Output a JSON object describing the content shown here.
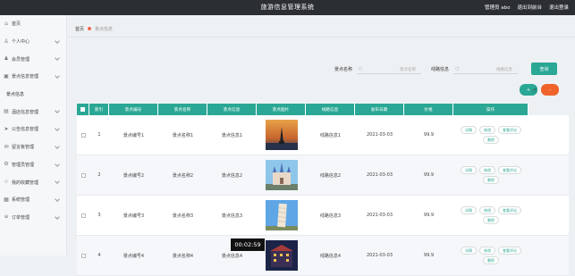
{
  "topbar": {
    "title": "旅游信息管理系统",
    "admin": "管理员 abo",
    "exit_console": "退出到前台",
    "logout": "退出登录"
  },
  "sidebar": {
    "items": [
      {
        "label": "首页",
        "icon": "home-icon",
        "chevron": false
      },
      {
        "label": "个人中心",
        "icon": "user-icon",
        "chevron": true
      },
      {
        "label": "会员管理",
        "icon": "users-icon",
        "chevron": true
      },
      {
        "label": "景点信息管理",
        "icon": "map-icon",
        "chevron": true
      },
      {
        "label": "景点信息",
        "icon": "",
        "chevron": false,
        "sub": true
      },
      {
        "label": "酒店信息管理",
        "icon": "hotel-icon",
        "chevron": true
      },
      {
        "label": "公告信息管理",
        "icon": "send-icon",
        "chevron": true
      },
      {
        "label": "留言板管理",
        "icon": "message-icon",
        "chevron": true
      },
      {
        "label": "管理员管理",
        "icon": "gear-icon",
        "chevron": true
      },
      {
        "label": "我的收藏管理",
        "icon": "star-icon",
        "chevron": true
      },
      {
        "label": "系统管理",
        "icon": "system-icon",
        "chevron": true
      },
      {
        "label": "订单管理",
        "icon": "order-icon",
        "chevron": true
      }
    ]
  },
  "breadcrumb": {
    "home": "首页",
    "current": "景点信息"
  },
  "search": {
    "name_label": "景点名称",
    "name_placeholder": "景点名称",
    "route_label": "线路信息",
    "route_placeholder": "线路信息",
    "query_label": "查询"
  },
  "actions": {
    "add": "+",
    "delete": "-"
  },
  "table": {
    "headers": [
      "索引",
      "景点编号",
      "景点名称",
      "景点信息",
      "景点图片",
      "线路信息",
      "发布日期",
      "价格",
      "操作"
    ],
    "rows": [
      {
        "index": "1",
        "code": "景点编号1",
        "name": "景点名称1",
        "info": "景点信息1",
        "route": "线路信息1",
        "date": "2021-03-03",
        "price": "99.9",
        "img": "sunset"
      },
      {
        "index": "2",
        "code": "景点编号2",
        "name": "景点名称2",
        "info": "景点信息2",
        "route": "线路信息2",
        "date": "2021-03-03",
        "price": "99.9",
        "img": "castle"
      },
      {
        "index": "3",
        "code": "景点编号3",
        "name": "景点名称3",
        "info": "景点信息3",
        "route": "线路信息3",
        "date": "2021-03-03",
        "price": "99.9",
        "img": "tower"
      },
      {
        "index": "4",
        "code": "景点编号4",
        "name": "景点名称4",
        "info": "景点信息4",
        "route": "线路信息4",
        "date": "2021-03-03",
        "price": "99.9",
        "img": "night"
      }
    ],
    "ops": [
      "详情",
      "修改",
      "查看评论",
      "删除"
    ]
  },
  "video_timer": "00:02:59",
  "colors": {
    "accent": "#2aa795",
    "danger": "#f0642b",
    "topbar": "#2b2e33"
  }
}
